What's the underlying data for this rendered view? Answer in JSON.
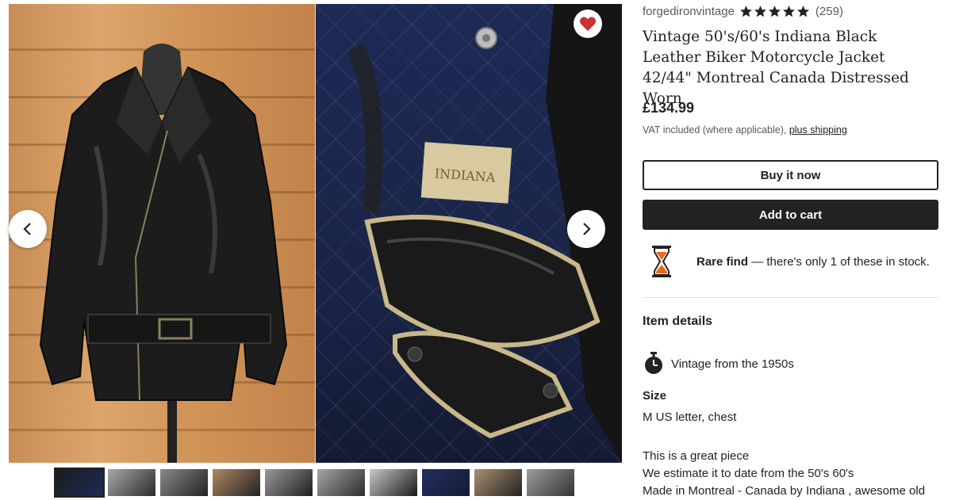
{
  "gallery": {
    "prev_label": "Previous image",
    "next_label": "Next image",
    "favorite_color": "#c83232",
    "thumbnail_count": 10
  },
  "shop": {
    "name": "forgedironvintage",
    "rating": 5,
    "reviews": "(259)"
  },
  "product": {
    "title": "Vintage 50's/60's Indiana Black Leather Biker Motorcycle Jacket 42/44\" Montreal Canada Distressed Worn",
    "price": "£134.99",
    "vat_text": "VAT included (where applicable), ",
    "shipping_link": "plus shipping"
  },
  "actions": {
    "buy_now": "Buy it now",
    "add_to_cart": "Add to cart"
  },
  "rare": {
    "bold": "Rare find",
    "rest": " — there's only 1 of these in stock.",
    "accent": "#f1641e"
  },
  "details": {
    "heading": "Item details",
    "vintage": "Vintage from the 1950s",
    "size_heading": "Size",
    "size_value": "M US letter, chest",
    "description": [
      "This is a great piece",
      "We estimate it to date from the 50's 60's",
      "Made in Montreal - Canada by Indiana , awesome old"
    ]
  }
}
